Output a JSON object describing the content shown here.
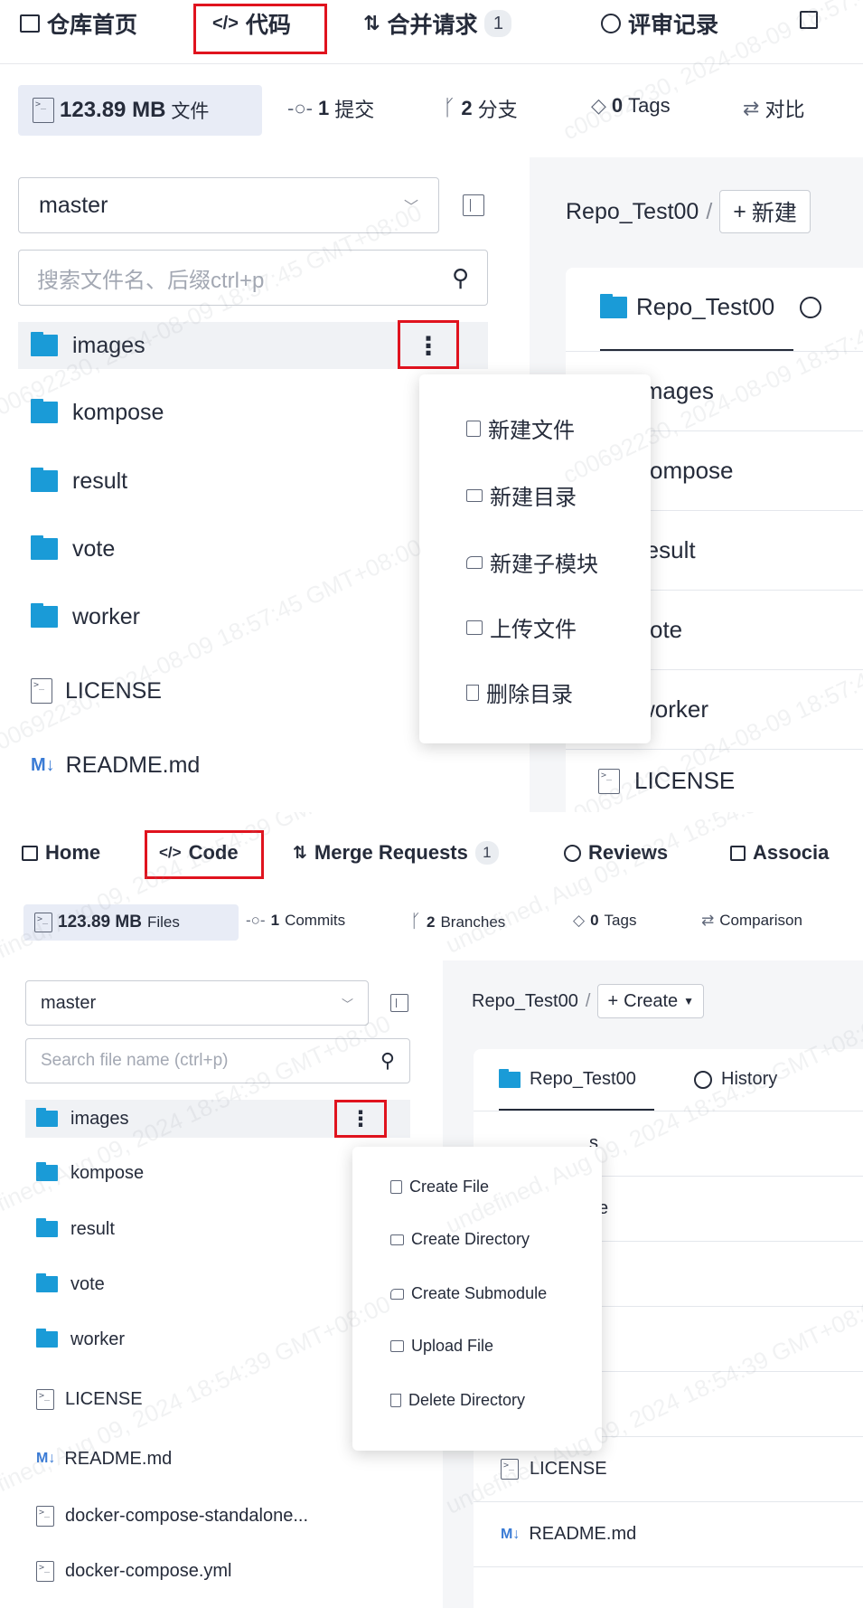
{
  "zh": {
    "tabs": [
      {
        "label": "仓库首页",
        "icon": "home-icon"
      },
      {
        "label": "代码",
        "icon": "code-icon"
      },
      {
        "label": "合并请求",
        "icon": "merge-request-icon",
        "badge": "1"
      },
      {
        "label": "评审记录",
        "icon": "review-icon"
      }
    ],
    "stats": {
      "size": "123.89 MB",
      "size_label": "文件",
      "commits_count": "1",
      "commits_label": "提交",
      "branches_count": "2",
      "branches_label": "分支",
      "tags_count": "0",
      "tags_label": "Tags",
      "compare_label": "对比"
    },
    "branch": "master",
    "search_placeholder": "搜索文件名、后缀ctrl+p",
    "tree": [
      "images",
      "kompose",
      "result",
      "vote",
      "worker",
      "LICENSE",
      "README.md"
    ],
    "readme_badge": "M↓",
    "breadcrumb_repo": "Repo_Test00",
    "breadcrumb_sep": "/",
    "create_label": "新建",
    "card_tab": "Repo_Test00",
    "rows": [
      "images",
      "kompose",
      "result",
      "vote",
      "worker",
      "LICENSE"
    ],
    "menu": [
      "新建文件",
      "新建目录",
      "新建子模块",
      "上传文件",
      "删除目录"
    ],
    "watermark": "c00692230, 2024-08-09 18:57:45 GMT+08:00"
  },
  "en": {
    "tabs": [
      {
        "label": "Home",
        "icon": "home-icon"
      },
      {
        "label": "Code",
        "icon": "code-icon"
      },
      {
        "label": "Merge Requests",
        "icon": "merge-request-icon",
        "badge": "1"
      },
      {
        "label": "Reviews",
        "icon": "review-icon"
      },
      {
        "label": "Associa",
        "icon": "associated-icon"
      }
    ],
    "stats": {
      "size": "123.89 MB",
      "size_label": "Files",
      "commits_count": "1",
      "commits_label": "Commits",
      "branches_count": "2",
      "branches_label": "Branches",
      "tags_count": "0",
      "tags_label": "Tags",
      "compare_label": "Comparison"
    },
    "branch": "master",
    "search_placeholder": "Search file name (ctrl+p)",
    "tree": [
      "images",
      "kompose",
      "result",
      "vote",
      "worker",
      "LICENSE",
      "README.md",
      "docker-compose-standalone...",
      "docker-compose.yml"
    ],
    "readme_badge": "M↓",
    "breadcrumb_repo": "Repo_Test00",
    "breadcrumb_sep": "/",
    "create_label": "Create",
    "card_tab": "Repo_Test00",
    "history_label": "History",
    "rows": [
      "s",
      "se",
      "",
      "",
      "",
      "LICENSE",
      "README.md"
    ],
    "menu": [
      "Create File",
      "Create Directory",
      "Create Submodule",
      "Upload File",
      "Delete Directory"
    ],
    "watermark": "undefined, Aug 09, 2024 18:54:39 GMT+08:00"
  }
}
